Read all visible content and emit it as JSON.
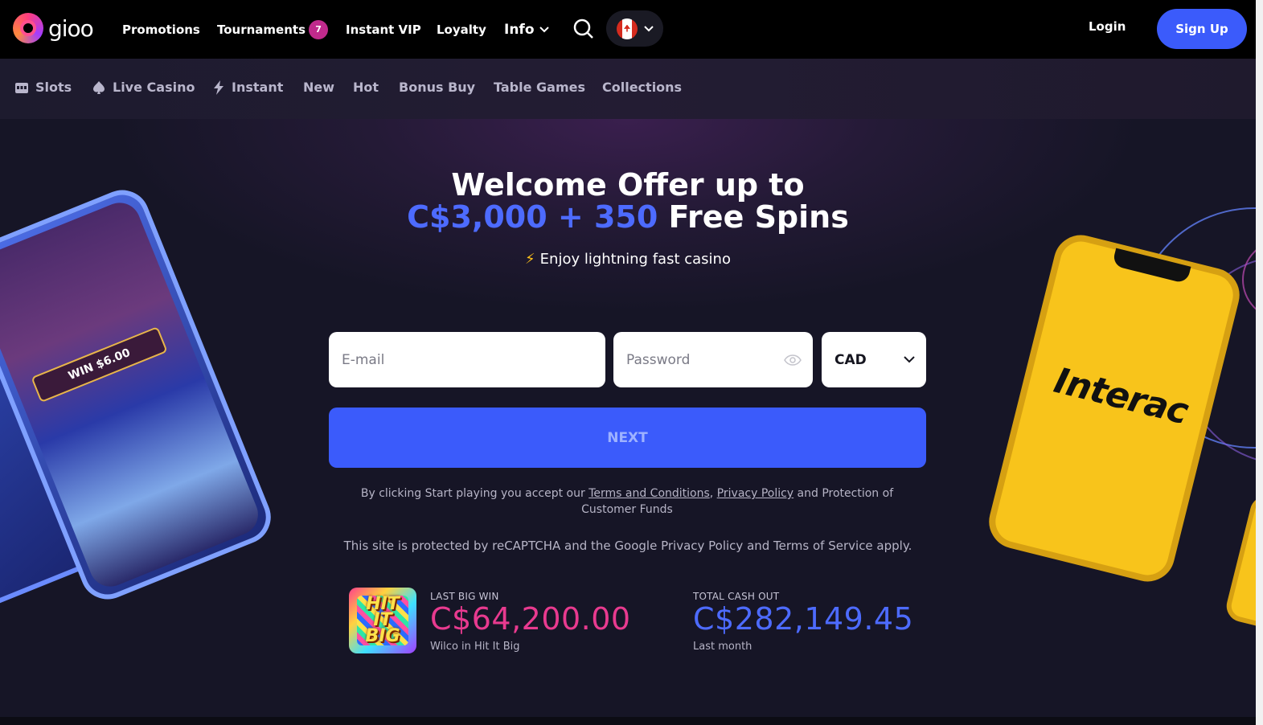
{
  "header": {
    "logo_text": "gioo",
    "nav": [
      {
        "label": "Promotions"
      },
      {
        "label": "Tournaments",
        "badge": "7"
      },
      {
        "label": "Instant VIP"
      },
      {
        "label": "Loyalty"
      },
      {
        "label": "Info"
      }
    ],
    "login_label": "Login",
    "signup_label": "Sign Up",
    "colors": {
      "accent": "#3b5bfb",
      "badge": "#c02a8c"
    }
  },
  "categories": [
    {
      "label": "Slots",
      "icon": "slot-machine-icon"
    },
    {
      "label": "Live Casino",
      "icon": "spade-icon"
    },
    {
      "label": "Instant",
      "icon": "lightning-icon"
    },
    {
      "label": "New"
    },
    {
      "label": "Hot"
    },
    {
      "label": "Bonus Buy"
    },
    {
      "label": "Table Games"
    },
    {
      "label": "Collections"
    }
  ],
  "hero": {
    "title_line1": "Welcome Offer up to",
    "title_accent": "C$3,000 + 350",
    "title_rest": " Free Spins",
    "subtitle": "Enjoy lightning fast casino",
    "colors": {
      "accent": "#4d6bff",
      "bolt": "#ffc21a"
    }
  },
  "form": {
    "email_placeholder": "E-mail",
    "password_placeholder": "Password",
    "currency": "CAD",
    "next_label": "NEXT",
    "terms_prefix": "By clicking Start playing you accept our ",
    "terms_link": "Terms and Conditions",
    "terms_sep": ", ",
    "privacy_link": "Privacy Policy",
    "terms_suffix": " and Protection of Customer Funds",
    "recaptcha": "This site is protected by reCAPTCHA and the Google Privacy Policy and Terms of Service apply."
  },
  "stats": {
    "thumb_text": "HIT IT BIG",
    "last_win_label": "LAST BIG WIN",
    "last_win_value": "C$64,200.00",
    "last_win_sub": "Wilco in Hit It Big",
    "total_label": "TOTAL CASH OUT",
    "total_value": "C$282,149.45",
    "total_sub": "Last month",
    "colors": {
      "win": "#e83a8f",
      "total": "#4d6bff"
    }
  },
  "decor": {
    "left_phone_win": "WIN $6.00",
    "right_phone_brand": "Interac"
  }
}
